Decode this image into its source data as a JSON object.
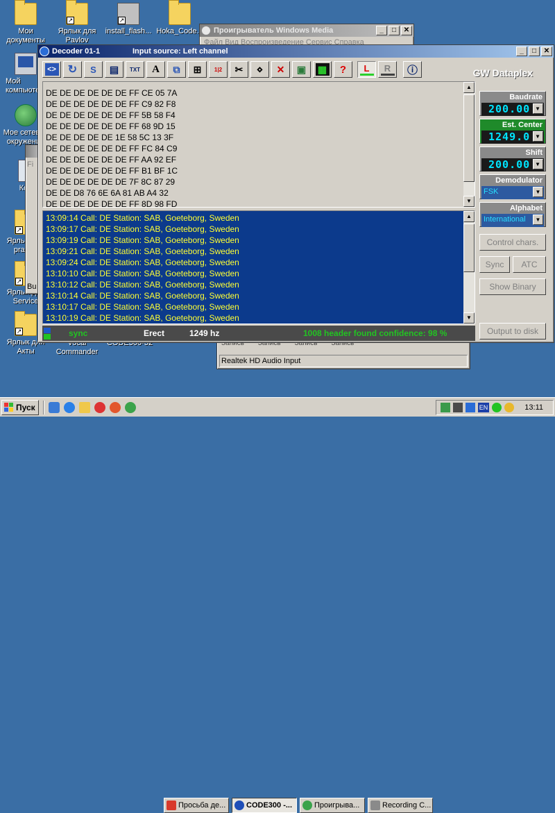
{
  "desktop": {
    "icons": [
      {
        "label": "Мои документы"
      },
      {
        "label": "Ярлык для Pavlov"
      },
      {
        "label": "install_flash..."
      },
      {
        "label": "Hoka_Code..."
      },
      {
        "label": "Мой компьютер"
      },
      {
        "label": "Мое сетевое окружение"
      },
      {
        "label": "Кор"
      },
      {
        "label": "Ярлык для prague"
      },
      {
        "label": "Ярлык для Service"
      },
      {
        "label": "Ярлык для Акты"
      },
      {
        "label": "Vocal Commander"
      },
      {
        "label": "CODE300-32"
      }
    ]
  },
  "wmp_window": {
    "title": "Проигрыватель Windows Media",
    "menu_partial": "Файл  Вид  Воспроизведение  Сервис  Справка"
  },
  "bg_window": {
    "title_partial": "Fi",
    "status_partial": "Bu"
  },
  "audio_window": {
    "slot_labels": [
      "Запись",
      "Запись",
      "Запись",
      "Запись"
    ],
    "input_label": "Realtek HD Audio Input"
  },
  "decoder": {
    "title": "Decoder 01-1",
    "input_source": "Input source: Left channel",
    "brand": "GW Dataplex",
    "toolbar_glyphs": [
      "<>",
      "↻",
      "S",
      "▤",
      "TXT",
      "A",
      "⧉",
      "⊞",
      "1|2",
      "✂",
      "⋄",
      "✕",
      "▣",
      "▦",
      "?",
      "L",
      "R",
      "ⓘ"
    ],
    "hex_lines": [
      "DE DE DE DE DE DE FF CE 05 7A",
      "DE DE DE DE DE DE FF C9 82 F8",
      "DE DE DE DE DE DE FF 5B 58 F4",
      "DE DE DE DE DE DE FF 68 9D 15",
      "DE DE DE DE DE 1E 58 5C 13 3F",
      "DE DE DE DE DE DE FF FC 84 C9",
      "DE DE DE DE DE DE FF AA 92 EF",
      "DE DE DE DE DE DE FF B1 BF 1C",
      "DE DE DE DE DE DE 7F 8C 87 29",
      "DE DE D8 76 6E 6A 81 AB A4 32",
      "DE DE DE DE DE DE FF 8D 98 FD"
    ],
    "log_lines": [
      "13:09:14 Call: DE  Station: SAB, Goeteborg, Sweden",
      "13:09:17 Call: DE  Station: SAB, Goeteborg, Sweden",
      "13:09:19 Call: DE  Station: SAB, Goeteborg, Sweden",
      "13:09:21 Call: DE  Station: SAB, Goeteborg, Sweden",
      "13:09:24 Call: DE  Station: SAB, Goeteborg, Sweden",
      "13:10:10 Call: DE  Station: SAB, Goeteborg, Sweden",
      "13:10:12 Call: DE  Station: SAB, Goeteborg, Sweden",
      "13:10:14 Call: DE  Station: SAB, Goeteborg, Sweden",
      "13:10:17 Call: DE  Station: SAB, Goeteborg, Sweden",
      "13:10:19 Call: DE  Station: SAB, Goeteborg, Sweden"
    ],
    "status": {
      "sync": "sync",
      "erect": "Erect",
      "freq": "1249 hz",
      "message": "1008 header found confidence: 98 %"
    },
    "panel": {
      "baudrate_label": "Baudrate",
      "baudrate_value": "200.00",
      "est_center_label": "Est. Center",
      "est_center_value": "1249.0",
      "shift_label": "Shift",
      "shift_value": "200.00",
      "demodulator_label": "Demodulator",
      "demodulator_value": "FSK",
      "alphabet_label": "Alphabet",
      "alphabet_value": "International",
      "control_chars": "Control chars.",
      "sync_btn": "Sync",
      "atc_btn": "ATC",
      "show_binary": "Show Binary",
      "output_to_disk": "Output to disk"
    }
  },
  "taskbar": {
    "start": "Пуск",
    "tasks": [
      {
        "label": "Просьба де..."
      },
      {
        "label": "CODE300 -..."
      },
      {
        "label": "Проигрыва..."
      },
      {
        "label": "Recording C..."
      }
    ],
    "tray_lang": "EN",
    "clock": "13:11"
  },
  "colors": {
    "desktop": "#3a6ea5",
    "title_active": "#0a246a",
    "log_bg": "#0c3a8c",
    "log_text": "#ffff33",
    "lcd_text": "#00e5ff",
    "status_green": "#22c322"
  }
}
